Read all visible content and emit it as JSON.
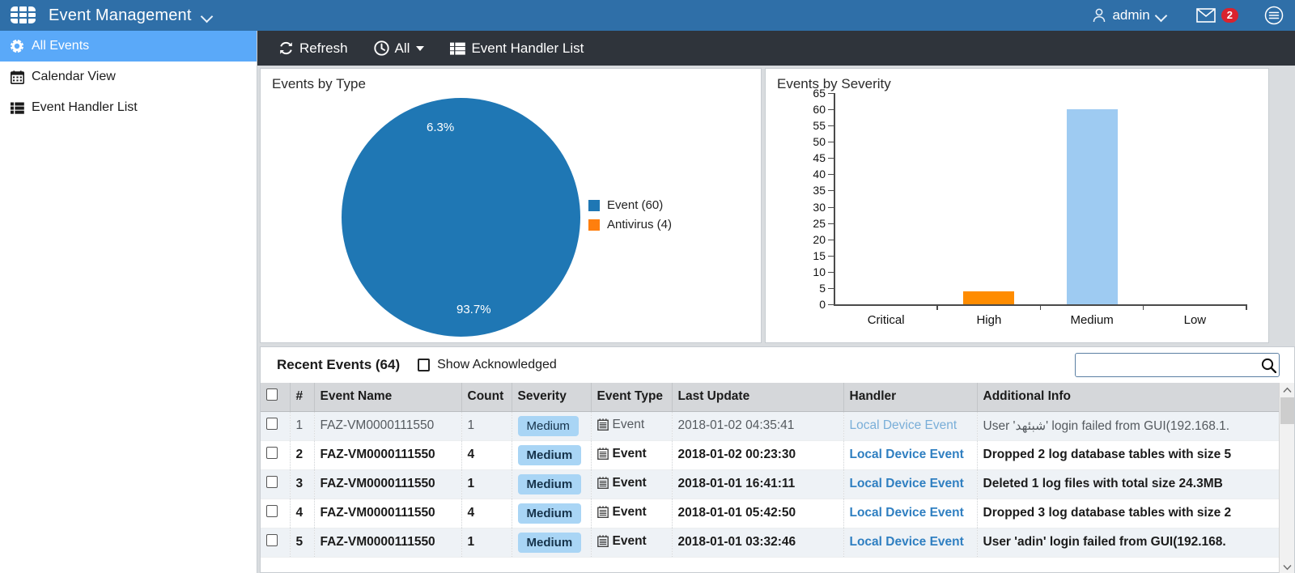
{
  "header": {
    "app_title": "Event Management",
    "logo_icon": "grid-logo-icon",
    "title_caret_icon": "chevron-down-icon",
    "user_name": "admin",
    "user_icon": "person-icon",
    "user_caret_icon": "chevron-down-icon",
    "mail_icon": "envelope-icon",
    "mail_count": "2",
    "menu_icon": "hamburger-menu-icon",
    "brand_color": "#2f6fa8"
  },
  "sidebar": {
    "items": [
      {
        "label": "All Events",
        "icon": "gear-burst-icon",
        "active": true
      },
      {
        "label": "Calendar View",
        "icon": "calendar-icon",
        "active": false
      },
      {
        "label": "Event Handler List",
        "icon": "list-icon",
        "active": false
      }
    ],
    "active_color": "#5aa9f9"
  },
  "toolbar": {
    "refresh_label": "Refresh",
    "refresh_icon": "refresh-icon",
    "time_range_label": "All",
    "time_range_icon": "clock-icon",
    "event_handler_label": "Event Handler List",
    "event_handler_icon": "list-icon",
    "background": "#2f343b"
  },
  "chart_data": [
    {
      "type": "pie",
      "title": "Events by Type",
      "labels": [
        "Event",
        "Antivirus"
      ],
      "values": [
        60,
        4
      ],
      "percent_labels": [
        "93.7%",
        "6.3%"
      ],
      "legend": [
        "Event (60)",
        "Antivirus (4)"
      ],
      "legend_position": "right",
      "colors": [
        "#1f77b4",
        "#ff7f0e"
      ]
    },
    {
      "type": "bar",
      "title": "Events by Severity",
      "categories": [
        "Critical",
        "High",
        "Medium",
        "Low"
      ],
      "values": [
        0,
        4,
        60,
        0
      ],
      "colors": [
        "#d62728",
        "#ff8c00",
        "#9ecbf2",
        "#9ecbf2"
      ],
      "xlabel": "",
      "ylabel": "",
      "ylim": [
        0,
        65
      ],
      "yticks": [
        0,
        5,
        10,
        15,
        20,
        25,
        30,
        35,
        40,
        45,
        50,
        55,
        60,
        65
      ],
      "grid": false
    }
  ],
  "table_panel": {
    "title": "Recent Events (64)",
    "show_acknowledged_label": "Show Acknowledged",
    "show_acknowledged_checked": false,
    "search_value": "",
    "search_placeholder": "",
    "search_icon": "search-icon",
    "scroll_up_icon": "chevron-up-icon",
    "scroll_down_icon": "chevron-down-icon",
    "columns": [
      "",
      "#",
      "Event Name",
      "Count",
      "Severity",
      "Event Type",
      "Last Update",
      "Handler",
      "Additional Info"
    ],
    "rows": [
      {
        "num": "1",
        "event_name": "FAZ-VM0000111550",
        "count": "1",
        "severity": "Medium",
        "event_type": "Event",
        "last_update": "2018-01-02 04:35:41",
        "handler": "Local Device Event",
        "additional_info": "User 'شبئهد' login failed from GUI(192.168.1.",
        "unread": false
      },
      {
        "num": "2",
        "event_name": "FAZ-VM0000111550",
        "count": "4",
        "severity": "Medium",
        "event_type": "Event",
        "last_update": "2018-01-02 00:23:30",
        "handler": "Local Device Event",
        "additional_info": "Dropped 2 log database tables with size 5",
        "unread": true
      },
      {
        "num": "3",
        "event_name": "FAZ-VM0000111550",
        "count": "1",
        "severity": "Medium",
        "event_type": "Event",
        "last_update": "2018-01-01 16:41:11",
        "handler": "Local Device Event",
        "additional_info": "Deleted 1 log files with total size 24.3MB",
        "unread": true
      },
      {
        "num": "4",
        "event_name": "FAZ-VM0000111550",
        "count": "4",
        "severity": "Medium",
        "event_type": "Event",
        "last_update": "2018-01-01 05:42:50",
        "handler": "Local Device Event",
        "additional_info": "Dropped 3 log database tables with size 2",
        "unread": true
      },
      {
        "num": "5",
        "event_name": "FAZ-VM0000111550",
        "count": "1",
        "severity": "Medium",
        "event_type": "Event",
        "last_update": "2018-01-01 03:32:46",
        "handler": "Local Device Event",
        "additional_info": "User 'adin' login failed from GUI(192.168.",
        "unread": true
      }
    ],
    "severity_badge_color": "#a9d5f5"
  }
}
